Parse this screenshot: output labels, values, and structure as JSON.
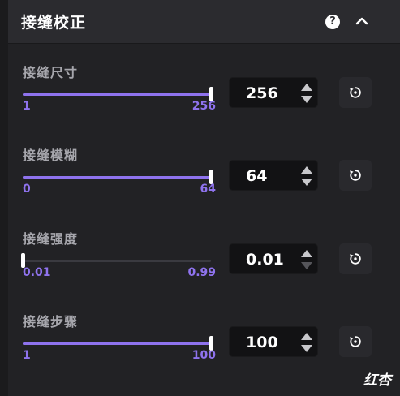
{
  "panel": {
    "title": "接缝校正",
    "help_icon": "question-circle-icon",
    "collapse_icon": "chevron-up-icon"
  },
  "sections": [
    {
      "label": "接缝尺寸",
      "min": "1",
      "max": "256",
      "value": "256",
      "fraction": 1.0,
      "disable_down": false,
      "disable_up": false
    },
    {
      "label": "接缝模糊",
      "min": "0",
      "max": "64",
      "value": "64",
      "fraction": 1.0,
      "disable_down": false,
      "disable_up": false
    },
    {
      "label": "接缝强度",
      "min": "0.01",
      "max": "0.99",
      "value": "0.01",
      "fraction": 0.0,
      "disable_down": true,
      "disable_up": false
    },
    {
      "label": "接缝步骤",
      "min": "1",
      "max": "100",
      "value": "100",
      "fraction": 1.0,
      "disable_down": false,
      "disable_up": false
    }
  ],
  "colors": {
    "accent": "#8f73ee",
    "spin_enabled": "#c8c8cc",
    "spin_disabled": "#55555a"
  },
  "watermark": "红杏"
}
